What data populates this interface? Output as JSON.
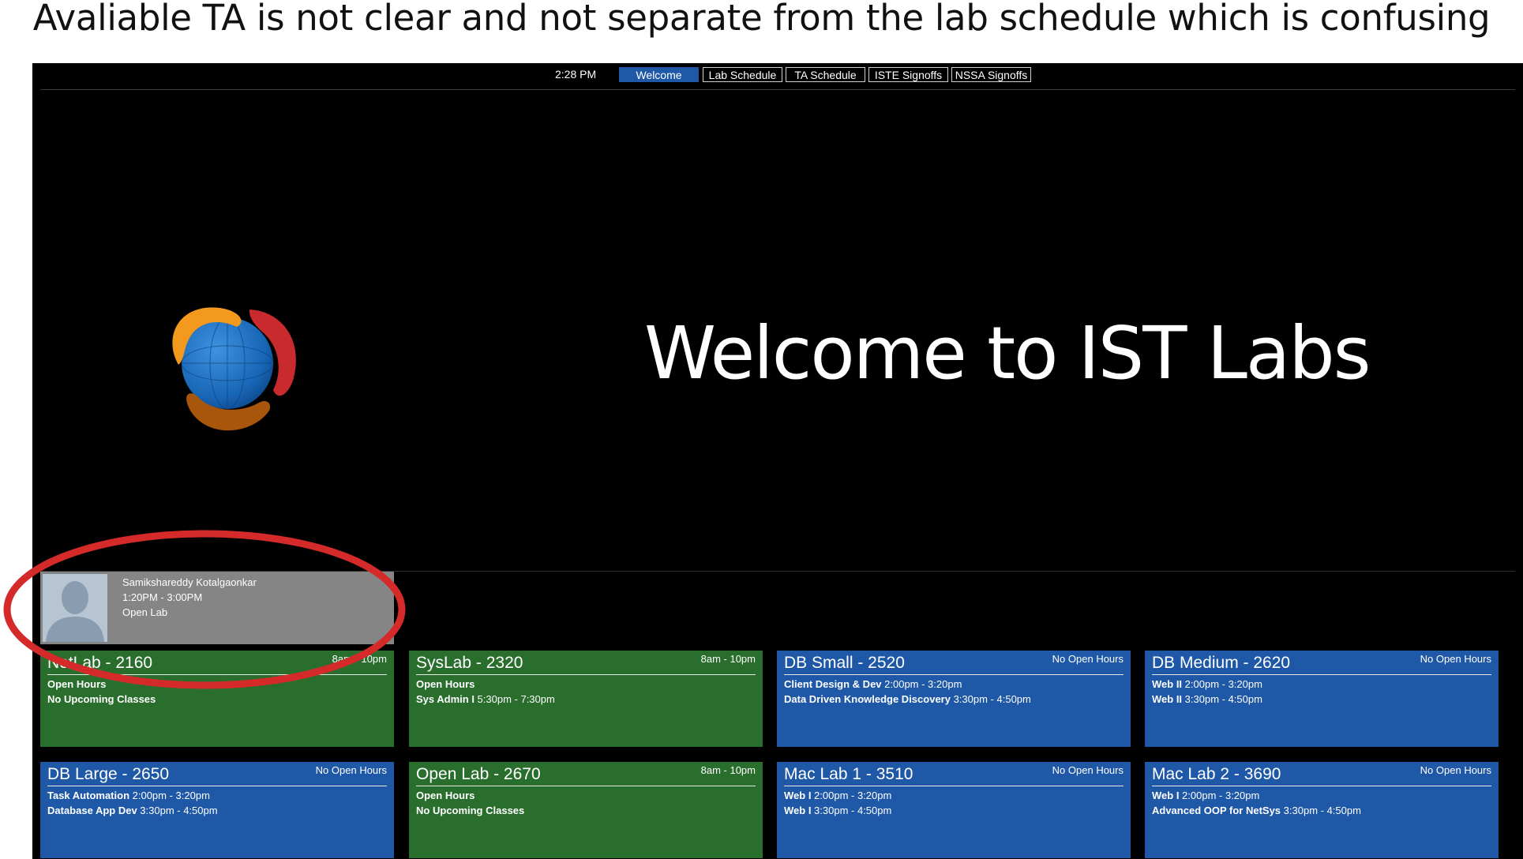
{
  "caption": "Avaliable TA is not clear and not separate from the lab schedule which is confusing",
  "nav": {
    "clock": "2:28 PM",
    "tabs": [
      "Welcome",
      "Lab Schedule",
      "TA Schedule",
      "ISTE Signoffs",
      "NSSA Signoffs"
    ],
    "active_tab": "Welcome"
  },
  "hero": {
    "title": "Welcome to IST Labs",
    "logo_icon": "globe-swirl-logo"
  },
  "ta": {
    "name": "Samikshareddy Kotalgaonkar",
    "time": "1:20PM - 3:00PM",
    "location": "Open Lab",
    "avatar_icon": "person-silhouette-icon"
  },
  "colors": {
    "open_lab": "#2a6e2e",
    "closed_lab": "#1e58a7",
    "annotation": "#d42a2a",
    "active_tab": "#1e58a7"
  },
  "labs": [
    {
      "name": "NetLab - 2160",
      "hours": "8am - 10pm",
      "lines": [
        {
          "b": "Open Hours",
          "t": ""
        },
        {
          "b": "No Upcoming Classes",
          "t": ""
        }
      ]
    },
    {
      "name": "SysLab - 2320",
      "hours": "8am - 10pm",
      "lines": [
        {
          "b": "Open Hours",
          "t": ""
        },
        {
          "b": "Sys Admin I",
          "t": " 5:30pm - 7:30pm"
        }
      ]
    },
    {
      "name": "DB Small - 2520",
      "hours": "No Open Hours",
      "lines": [
        {
          "b": "Client Design & Dev",
          "t": " 2:00pm - 3:20pm"
        },
        {
          "b": "Data Driven Knowledge Discovery",
          "t": " 3:30pm - 4:50pm"
        }
      ]
    },
    {
      "name": "DB Medium - 2620",
      "hours": "No Open Hours",
      "lines": [
        {
          "b": "Web II",
          "t": " 2:00pm - 3:20pm"
        },
        {
          "b": "Web II",
          "t": " 3:30pm - 4:50pm"
        }
      ]
    },
    {
      "name": "DB Large - 2650",
      "hours": "No Open Hours",
      "lines": [
        {
          "b": "Task Automation",
          "t": " 2:00pm - 3:20pm"
        },
        {
          "b": "Database App Dev",
          "t": " 3:30pm - 4:50pm"
        }
      ]
    },
    {
      "name": "Open Lab - 2670",
      "hours": "8am - 10pm",
      "lines": [
        {
          "b": "Open Hours",
          "t": ""
        },
        {
          "b": "No Upcoming Classes",
          "t": ""
        }
      ]
    },
    {
      "name": "Mac Lab 1 - 3510",
      "hours": "No Open Hours",
      "lines": [
        {
          "b": "Web I",
          "t": " 2:00pm - 3:20pm"
        },
        {
          "b": "Web I",
          "t": " 3:30pm - 4:50pm"
        }
      ]
    },
    {
      "name": "Mac Lab 2 - 3690",
      "hours": "No Open Hours",
      "lines": [
        {
          "b": "Web I",
          "t": " 2:00pm - 3:20pm"
        },
        {
          "b": "Advanced OOP for NetSys",
          "t": " 3:30pm - 4:50pm"
        }
      ]
    }
  ]
}
